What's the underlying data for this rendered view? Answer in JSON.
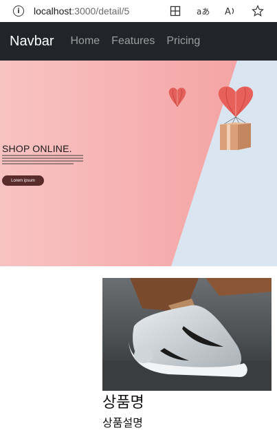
{
  "browser": {
    "url_host": "localhost",
    "url_path": ":3000/detail/5",
    "tools": [
      "tab-icon",
      "read-aloud-icon",
      "text-icon",
      "favorite-icon"
    ]
  },
  "navbar": {
    "brand": "Navbar",
    "links": [
      "Home",
      "Features",
      "Pricing"
    ]
  },
  "hero": {
    "headline": "SHOP ONLINE.",
    "cta_label": "Lorem ipsum"
  },
  "product": {
    "title": "상품명",
    "subtitle": "상품설명"
  }
}
